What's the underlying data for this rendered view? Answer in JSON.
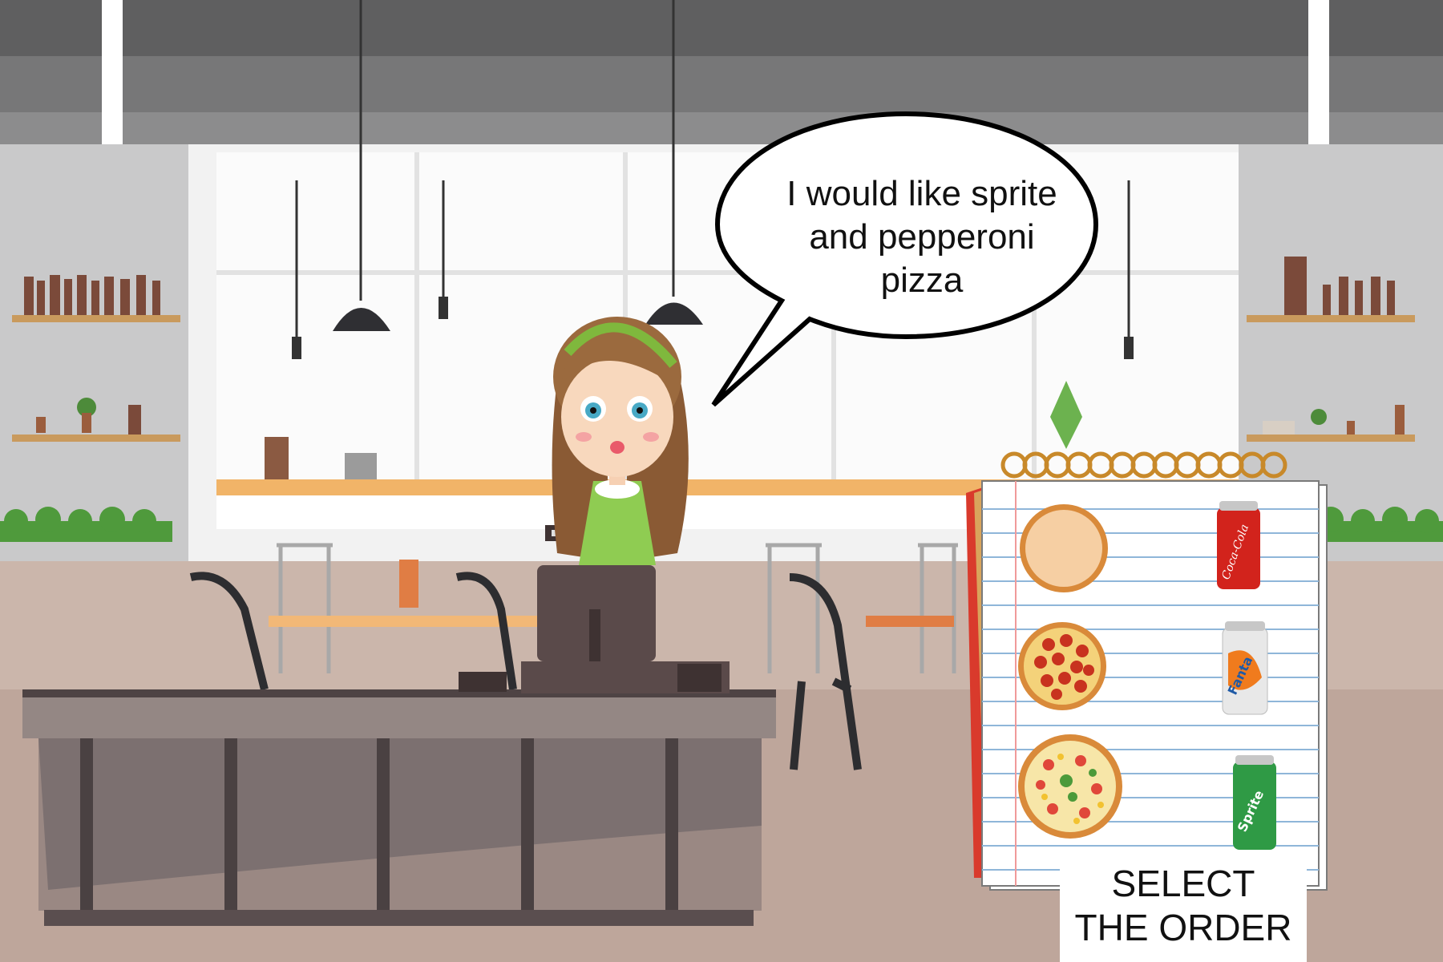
{
  "speech": {
    "text": "I would like sprite\nand pepperoni\npizza"
  },
  "button": {
    "line1": "SELECT",
    "line2": "THE ORDER"
  },
  "menu": {
    "pizzas": [
      {
        "name": "plain-cheese-pizza"
      },
      {
        "name": "pepperoni-pizza"
      },
      {
        "name": "veggie-pizza"
      }
    ],
    "drinks": [
      {
        "name": "coca-cola-can",
        "label": "Coca-Cola",
        "color": "#d2231c"
      },
      {
        "name": "fanta-can",
        "label": "Fanta",
        "color": "#e8e8e8"
      },
      {
        "name": "sprite-can",
        "label": "Sprite",
        "color": "#2f9a45"
      }
    ]
  }
}
